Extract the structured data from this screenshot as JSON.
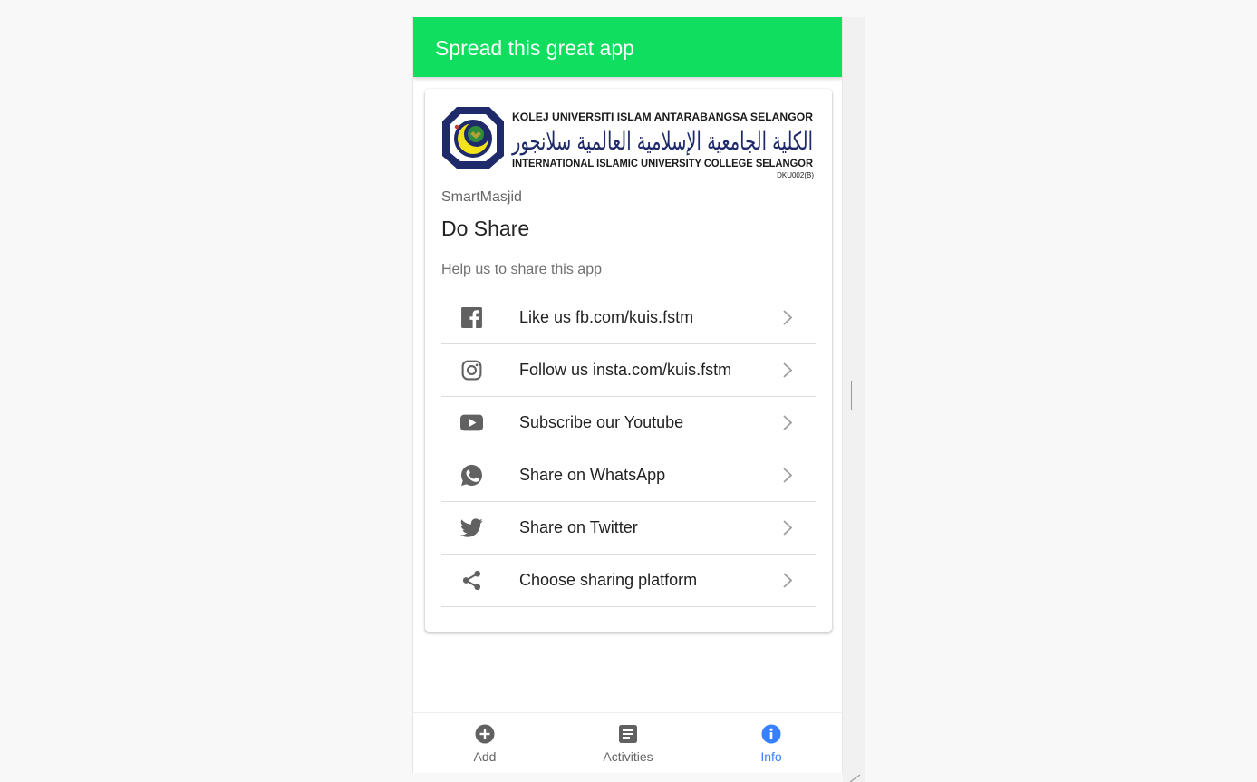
{
  "header": {
    "title": "Spread this great app"
  },
  "card": {
    "logo": {
      "line1": "KOLEJ UNIVERSITI ISLAM ANTARABANGSA SELANGOR",
      "line2": "الكلية الجامعية الإسلامية العالمية سلانجور",
      "line3": "INTERNATIONAL ISLAMIC UNIVERSITY COLLEGE SELANGOR",
      "code": "DKU002(B)"
    },
    "subtitle": "SmartMasjid",
    "title": "Do Share",
    "caption": "Help us to share this app",
    "items": [
      {
        "icon": "facebook-icon",
        "label": "Like us fb.com/kuis.fstm"
      },
      {
        "icon": "instagram-icon",
        "label": "Follow us insta.com/kuis.fstm"
      },
      {
        "icon": "youtube-icon",
        "label": "Subscribe our Youtube"
      },
      {
        "icon": "whatsapp-icon",
        "label": "Share on WhatsApp"
      },
      {
        "icon": "twitter-icon",
        "label": "Share on Twitter"
      },
      {
        "icon": "share-icon",
        "label": "Choose sharing platform"
      }
    ]
  },
  "tabs": [
    {
      "icon": "add-circle-icon",
      "label": "Add",
      "active": false
    },
    {
      "icon": "document-icon",
      "label": "Activities",
      "active": false
    },
    {
      "icon": "info-icon",
      "label": "Info",
      "active": true
    }
  ],
  "colors": {
    "header": "#10de5e",
    "active_tab": "#3880ff",
    "icon": "#616161",
    "logo_navy": "#1f2a6b",
    "logo_yellow": "#f4e21a"
  }
}
